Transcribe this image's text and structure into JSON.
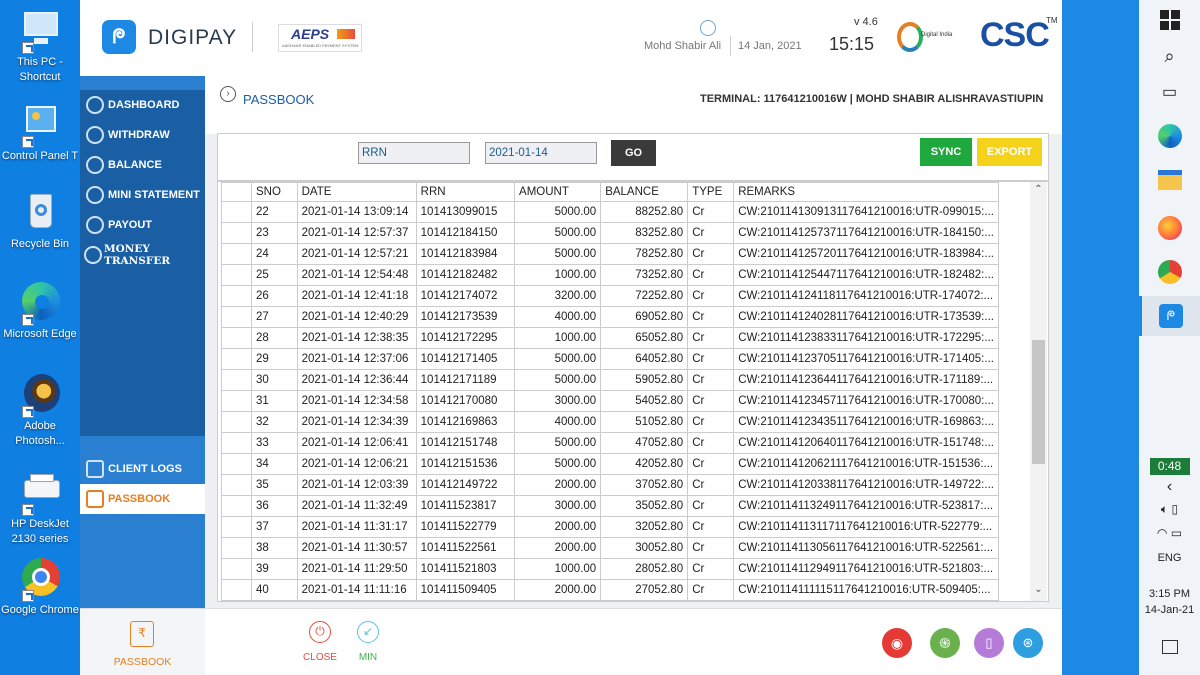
{
  "desktop": {
    "icons": [
      {
        "label": "This PC - Shortcut"
      },
      {
        "label": "Control Panel T"
      },
      {
        "label": "Recycle Bin"
      },
      {
        "label": "Microsoft Edge"
      },
      {
        "label": "Adobe Photosh..."
      },
      {
        "label": "HP DeskJet 2130 series"
      },
      {
        "label": "Google Chrome"
      }
    ]
  },
  "header": {
    "brand": "DIGIPAY",
    "aeps": "AEPS",
    "aeps_sub": "AADHAAR ENABLED PAYMENT SYSTEM",
    "user": "Mohd Shabir Ali",
    "date": "14 Jan, 2021",
    "version": "v 4.6",
    "time": "15:15",
    "digital_india": "Digital India",
    "csc": "CSC",
    "tm": "TM"
  },
  "nav": {
    "items": [
      {
        "label": "DASHBOARD"
      },
      {
        "label": "WITHDRAW"
      },
      {
        "label": "BALANCE"
      },
      {
        "label": "MINI STATEMENT"
      },
      {
        "label": "PAYOUT"
      },
      {
        "label": "MONEY TRANSFER"
      }
    ],
    "bottom": [
      {
        "label": "CLIENT LOGS"
      },
      {
        "label": "PASSBOOK"
      }
    ]
  },
  "page": {
    "title": "PASSBOOK",
    "terminal": "TERMINAL: 117641210016W | MOHD SHABIR ALI",
    "district": "SHRAVASTI",
    "state": "UPIN"
  },
  "filters": {
    "rrn_value": "RRN",
    "date_value": "2021-01-14",
    "go": "GO",
    "sync": "SYNC",
    "export": "EXPORT"
  },
  "table": {
    "headers": [
      "SNO",
      "DATE",
      "RRN",
      "AMOUNT",
      "BALANCE",
      "TYPE",
      "REMARKS"
    ],
    "rows": [
      [
        "22",
        "2021-01-14 13:09:14",
        "101413099015",
        "5000.00",
        "88252.80",
        "Cr",
        "CW:2101141309131176412100​16:UTR-099015:..."
      ],
      [
        "23",
        "2021-01-14 12:57:37",
        "101412184150",
        "5000.00",
        "83252.80",
        "Cr",
        "CW:210114125737117641210016:UTR-184150:..."
      ],
      [
        "24",
        "2021-01-14 12:57:21",
        "101412183984",
        "5000.00",
        "78252.80",
        "Cr",
        "CW:210114125720117641210016:UTR-183984:..."
      ],
      [
        "25",
        "2021-01-14 12:54:48",
        "101412182482",
        "1000.00",
        "73252.80",
        "Cr",
        "CW:210114125447117641210016:UTR-182482:..."
      ],
      [
        "26",
        "2021-01-14 12:41:18",
        "101412174072",
        "3200.00",
        "72252.80",
        "Cr",
        "CW:210114124118117641210016:UTR-174072:..."
      ],
      [
        "27",
        "2021-01-14 12:40:29",
        "101412173539",
        "4000.00",
        "69052.80",
        "Cr",
        "CW:210114124028117641210016:UTR-173539:..."
      ],
      [
        "28",
        "2021-01-14 12:38:35",
        "101412172295",
        "1000.00",
        "65052.80",
        "Cr",
        "CW:210114123833117641210016:UTR-172295:..."
      ],
      [
        "29",
        "2021-01-14 12:37:06",
        "101412171405",
        "5000.00",
        "64052.80",
        "Cr",
        "CW:210114123705117641210016:UTR-171405:..."
      ],
      [
        "30",
        "2021-01-14 12:36:44",
        "101412171189",
        "5000.00",
        "59052.80",
        "Cr",
        "CW:210114123644117641210016:UTR-171189:..."
      ],
      [
        "31",
        "2021-01-14 12:34:58",
        "101412170080",
        "3000.00",
        "54052.80",
        "Cr",
        "CW:210114123457117641210016:UTR-170080:..."
      ],
      [
        "32",
        "2021-01-14 12:34:39",
        "101412169863",
        "4000.00",
        "51052.80",
        "Cr",
        "CW:210114123435117641210016:UTR-169863:..."
      ],
      [
        "33",
        "2021-01-14 12:06:41",
        "101412151748",
        "5000.00",
        "47052.80",
        "Cr",
        "CW:210114120640117641210016:UTR-151748:..."
      ],
      [
        "34",
        "2021-01-14 12:06:21",
        "101412151536",
        "5000.00",
        "42052.80",
        "Cr",
        "CW:210114120621117641210016:UTR-151536:..."
      ],
      [
        "35",
        "2021-01-14 12:03:39",
        "101412149722",
        "2000.00",
        "37052.80",
        "Cr",
        "CW:210114120338117641210016:UTR-149722:..."
      ],
      [
        "36",
        "2021-01-14 11:32:49",
        "101411523817",
        "3000.00",
        "35052.80",
        "Cr",
        "CW:210114113249117641210016:UTR-523817:..."
      ],
      [
        "37",
        "2021-01-14 11:31:17",
        "101411522779",
        "2000.00",
        "32052.80",
        "Cr",
        "CW:210114113117117641210016:UTR-522779:..."
      ],
      [
        "38",
        "2021-01-14 11:30:57",
        "101411522561",
        "2000.00",
        "30052.80",
        "Cr",
        "CW:210114113056117641210016:UTR-522561:..."
      ],
      [
        "39",
        "2021-01-14 11:29:50",
        "101411521803",
        "1000.00",
        "28052.80",
        "Cr",
        "CW:210114112949117641210016:UTR-521803:..."
      ],
      [
        "40",
        "2021-01-14 11:11:16",
        "101411509405",
        "2000.00",
        "27052.80",
        "Cr",
        "CW:210114111115117641210016:UTR-509405:..."
      ]
    ]
  },
  "footer": {
    "passbook": "PASSBOOK",
    "close": "CLOSE",
    "min": "MIN"
  },
  "taskbar": {
    "battery": "0:48",
    "lang": "ENG",
    "time": "3:15 PM",
    "date": "14-Jan-21"
  }
}
